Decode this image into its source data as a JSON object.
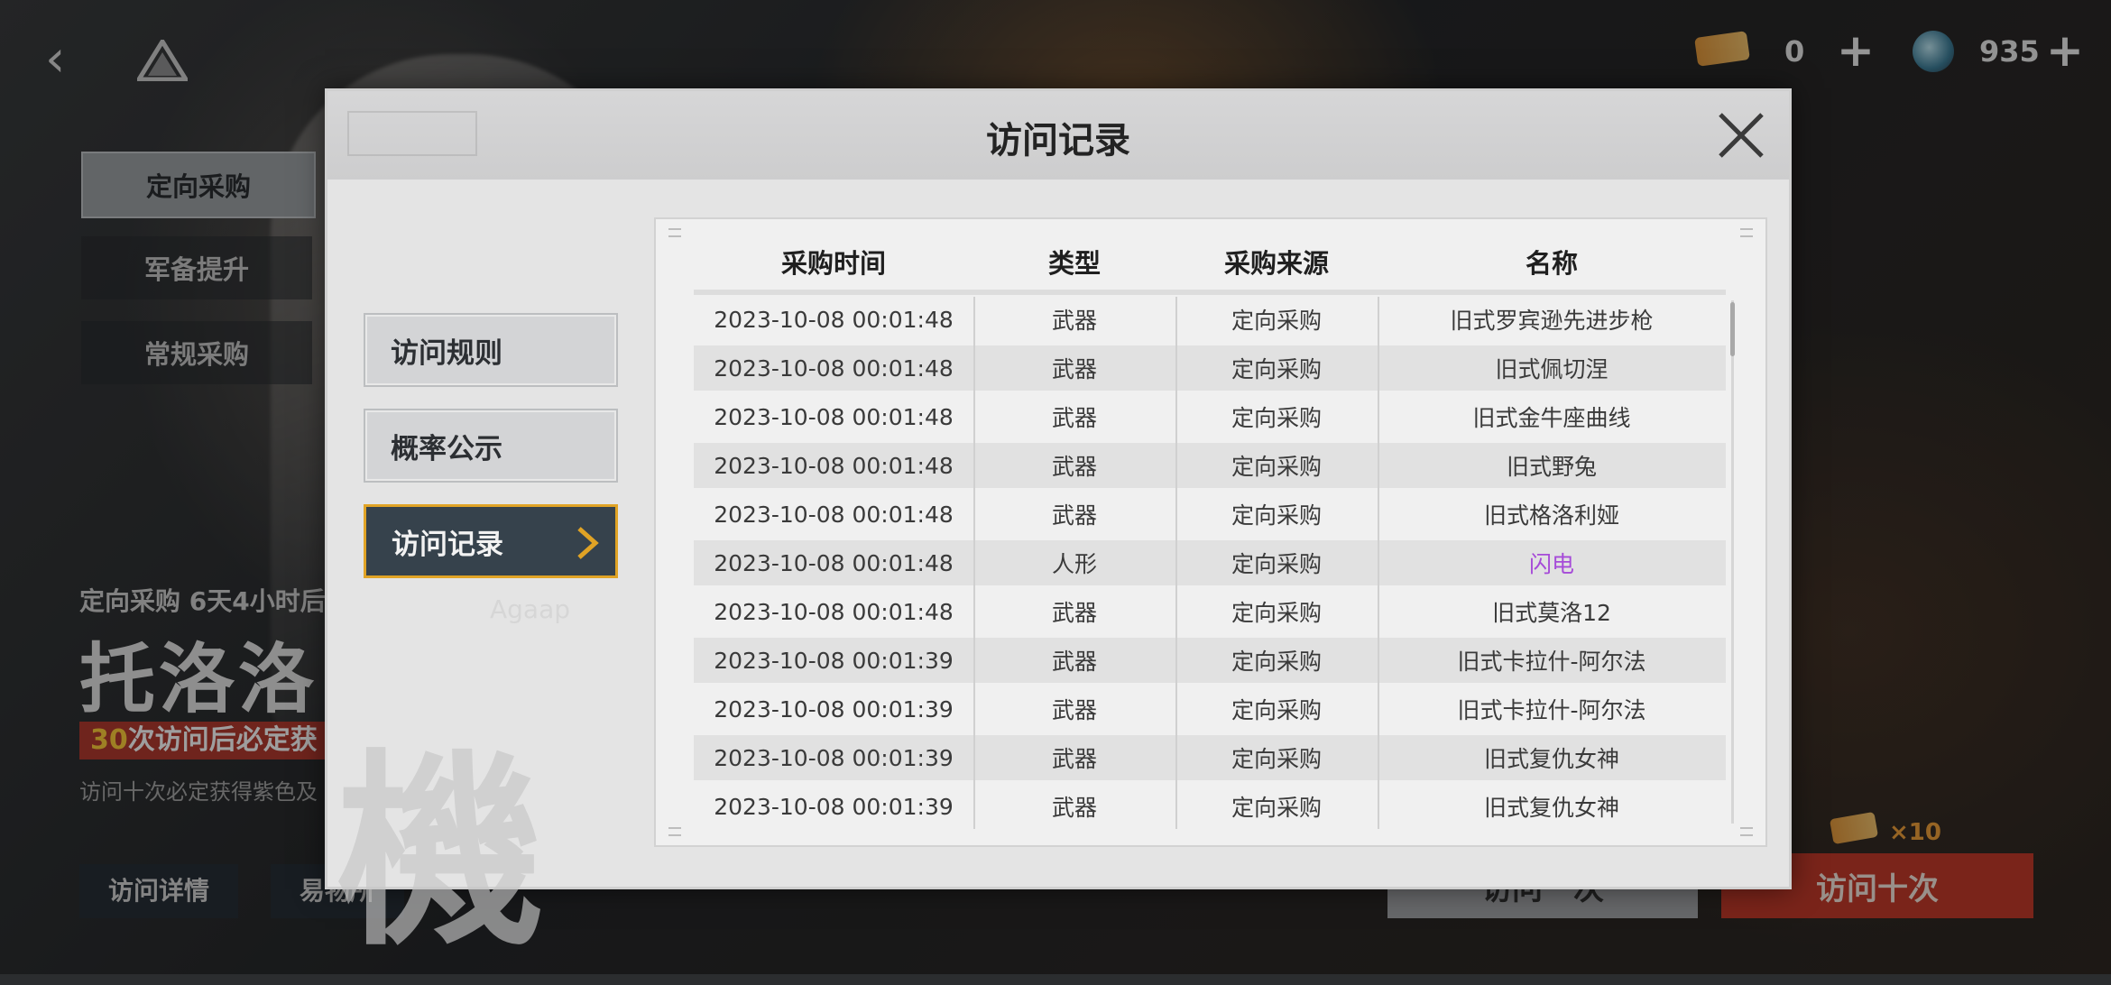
{
  "resources": {
    "ticket_count": "0",
    "crystal_count": "935",
    "plus": "+"
  },
  "background": {
    "tabs": [
      "定向采购",
      "军备提升",
      "常规采购"
    ],
    "banner_sub": "定向采购 6天4小时后",
    "banner_title": "托洛洛",
    "banner_red_num": "30",
    "banner_red_text": "次访问后必定获",
    "banner_note": "访问十次必定获得紫色及",
    "bottom_buttons": [
      "访问详情",
      "易物所"
    ],
    "draw_one": "访问一次",
    "draw_ten": "访问十次",
    "ten_multiplier": "×10",
    "watermark_label": "Agaap"
  },
  "modal": {
    "title": "访问记录",
    "menu": [
      {
        "label": "访问规则"
      },
      {
        "label": "概率公示"
      },
      {
        "label": "访问记录"
      }
    ],
    "kanji": "機",
    "table": {
      "columns": [
        "采购时间",
        "类型",
        "采购来源",
        "名称"
      ],
      "rows": [
        {
          "time": "2023-10-08 00:01:48",
          "type": "武器",
          "source": "定向采购",
          "name": "旧式罗宾逊先进步枪"
        },
        {
          "time": "2023-10-08 00:01:48",
          "type": "武器",
          "source": "定向采购",
          "name": "旧式佩切涅"
        },
        {
          "time": "2023-10-08 00:01:48",
          "type": "武器",
          "source": "定向采购",
          "name": "旧式金牛座曲线"
        },
        {
          "time": "2023-10-08 00:01:48",
          "type": "武器",
          "source": "定向采购",
          "name": "旧式野兔"
        },
        {
          "time": "2023-10-08 00:01:48",
          "type": "武器",
          "source": "定向采购",
          "name": "旧式格洛利娅"
        },
        {
          "time": "2023-10-08 00:01:48",
          "type": "人形",
          "source": "定向采购",
          "name": "闪电"
        },
        {
          "time": "2023-10-08 00:01:48",
          "type": "武器",
          "source": "定向采购",
          "name": "旧式莫洛12"
        },
        {
          "time": "2023-10-08 00:01:39",
          "type": "武器",
          "source": "定向采购",
          "name": "旧式卡拉什-阿尔法"
        },
        {
          "time": "2023-10-08 00:01:39",
          "type": "武器",
          "source": "定向采购",
          "name": "旧式卡拉什-阿尔法"
        },
        {
          "time": "2023-10-08 00:01:39",
          "type": "武器",
          "source": "定向采购",
          "name": "旧式复仇女神"
        },
        {
          "time": "2023-10-08 00:01:39",
          "type": "武器",
          "source": "定向采购",
          "name": "旧式复仇女神"
        }
      ]
    }
  },
  "colors": {
    "accent_gold": "#e0a325",
    "rare_purple": "#a64bd8",
    "danger_red": "#c53a2a"
  }
}
